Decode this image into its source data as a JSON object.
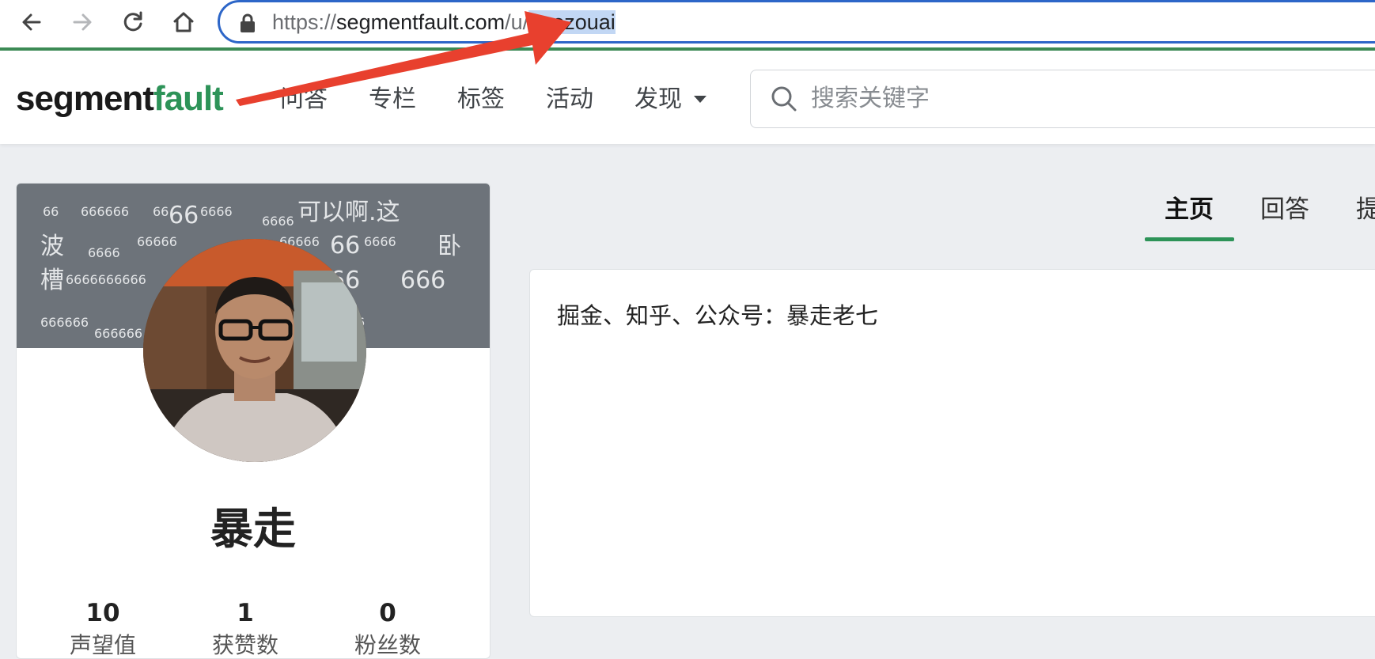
{
  "browser": {
    "url": {
      "scheme": "https://",
      "host": "segmentfault.c",
      "host_hidden_tail": "om",
      "path_prefix": "/u/",
      "path_selected": "baozouai"
    }
  },
  "site": {
    "logo_primary": "segment",
    "logo_accent": "fault",
    "nav": [
      "问答",
      "专栏",
      "标签",
      "活动",
      "发现"
    ],
    "search_placeholder": "搜索关键字"
  },
  "profile": {
    "name": "暴走",
    "danmu": [
      "66",
      "666666",
      "66",
      "66",
      "6666",
      "6666",
      "可以啊.这",
      "波",
      "6666",
      "66666",
      "66666",
      "66",
      "6666",
      "卧",
      "槽",
      "6666666666",
      "66",
      "666",
      "666666",
      "666666",
      "6"
    ],
    "stats": [
      {
        "value": "10",
        "label": "声望值"
      },
      {
        "value": "1",
        "label": "获赞数"
      },
      {
        "value": "0",
        "label": "粉丝数"
      }
    ]
  },
  "tabs": [
    "主页",
    "回答",
    "提"
  ],
  "intro": "掘金、知乎、公众号：暴走老七",
  "colors": {
    "brand_green": "#2d9358",
    "address_focus_blue": "#2d66c8",
    "annotation_red": "#e8402e",
    "banner_grey": "#6d737a"
  }
}
